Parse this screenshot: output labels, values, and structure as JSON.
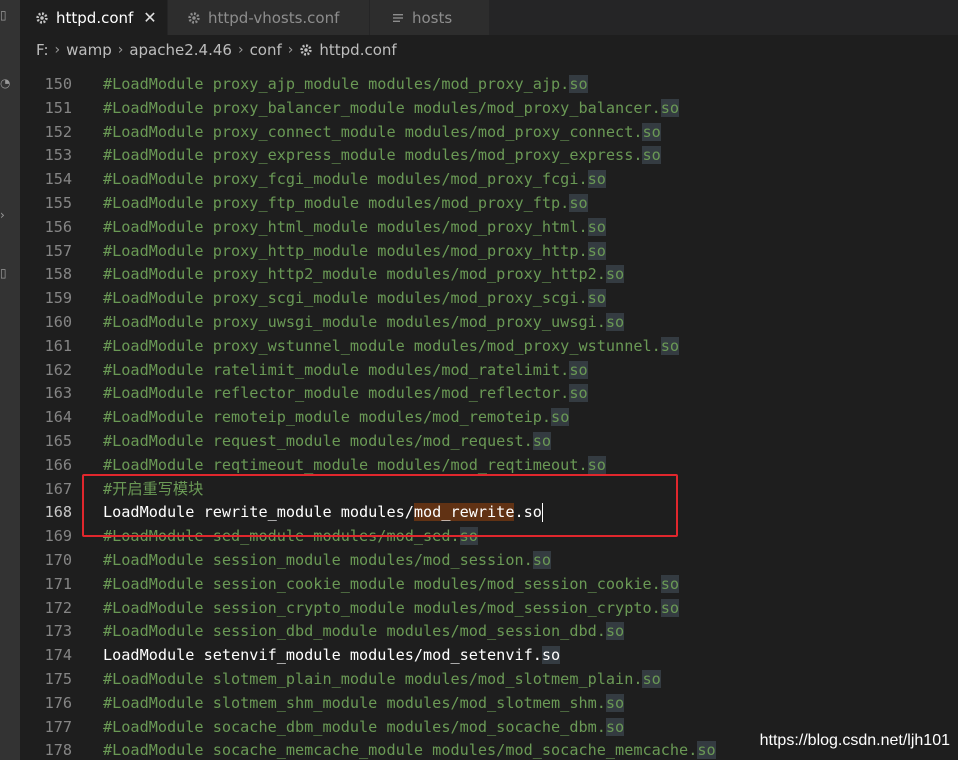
{
  "tabs": [
    {
      "label": "httpd.conf",
      "icon": "gear-icon",
      "active": true,
      "close": "✕"
    },
    {
      "label": "httpd-vhosts.conf",
      "icon": "gear-icon",
      "active": false
    },
    {
      "label": "hosts",
      "icon": "lines-icon",
      "active": false
    }
  ],
  "breadcrumb": [
    "F:",
    "wamp",
    "apache2.4.46",
    "conf",
    "httpd.conf"
  ],
  "editor": {
    "lines": [
      {
        "num": "150",
        "text": "#LoadModule proxy_ajp_module modules/mod_proxy_ajp.",
        "ext": "so",
        "comment": true
      },
      {
        "num": "151",
        "text": "#LoadModule proxy_balancer_module modules/mod_proxy_balancer.",
        "ext": "so",
        "comment": true
      },
      {
        "num": "152",
        "text": "#LoadModule proxy_connect_module modules/mod_proxy_connect.",
        "ext": "so",
        "comment": true
      },
      {
        "num": "153",
        "text": "#LoadModule proxy_express_module modules/mod_proxy_express.",
        "ext": "so",
        "comment": true
      },
      {
        "num": "154",
        "text": "#LoadModule proxy_fcgi_module modules/mod_proxy_fcgi.",
        "ext": "so",
        "comment": true
      },
      {
        "num": "155",
        "text": "#LoadModule proxy_ftp_module modules/mod_proxy_ftp.",
        "ext": "so",
        "comment": true
      },
      {
        "num": "156",
        "text": "#LoadModule proxy_html_module modules/mod_proxy_html.",
        "ext": "so",
        "comment": true
      },
      {
        "num": "157",
        "text": "#LoadModule proxy_http_module modules/mod_proxy_http.",
        "ext": "so",
        "comment": true
      },
      {
        "num": "158",
        "text": "#LoadModule proxy_http2_module modules/mod_proxy_http2.",
        "ext": "so",
        "comment": true
      },
      {
        "num": "159",
        "text": "#LoadModule proxy_scgi_module modules/mod_proxy_scgi.",
        "ext": "so",
        "comment": true
      },
      {
        "num": "160",
        "text": "#LoadModule proxy_uwsgi_module modules/mod_proxy_uwsgi.",
        "ext": "so",
        "comment": true
      },
      {
        "num": "161",
        "text": "#LoadModule proxy_wstunnel_module modules/mod_proxy_wstunnel.",
        "ext": "so",
        "comment": true
      },
      {
        "num": "162",
        "text": "#LoadModule ratelimit_module modules/mod_ratelimit.",
        "ext": "so",
        "comment": true
      },
      {
        "num": "163",
        "text": "#LoadModule reflector_module modules/mod_reflector.",
        "ext": "so",
        "comment": true
      },
      {
        "num": "164",
        "text": "#LoadModule remoteip_module modules/mod_remoteip.",
        "ext": "so",
        "comment": true
      },
      {
        "num": "165",
        "text": "#LoadModule request_module modules/mod_request.",
        "ext": "so",
        "comment": true
      },
      {
        "num": "166",
        "text": "#LoadModule reqtimeout_module modules/mod_reqtimeout.",
        "ext": "so",
        "comment": true
      },
      {
        "num": "167",
        "text": "#开启重写模块",
        "ext": "",
        "comment": true
      },
      {
        "num": "168",
        "text": "LoadModule rewrite_module modules/",
        "sel": "mod_rewrite",
        "after": ".so",
        "ext": "",
        "comment": false,
        "current": true
      },
      {
        "num": "169",
        "text": "#LoadModule sed_module modules/mod_sed.",
        "ext": "so",
        "comment": true
      },
      {
        "num": "170",
        "text": "#LoadModule session_module modules/mod_session.",
        "ext": "so",
        "comment": true
      },
      {
        "num": "171",
        "text": "#LoadModule session_cookie_module modules/mod_session_cookie.",
        "ext": "so",
        "comment": true
      },
      {
        "num": "172",
        "text": "#LoadModule session_crypto_module modules/mod_session_crypto.",
        "ext": "so",
        "comment": true
      },
      {
        "num": "173",
        "text": "#LoadModule session_dbd_module modules/mod_session_dbd.",
        "ext": "so",
        "comment": true
      },
      {
        "num": "174",
        "text": "LoadModule setenvif_module modules/mod_setenvif.",
        "ext": "so",
        "comment": false
      },
      {
        "num": "175",
        "text": "#LoadModule slotmem_plain_module modules/mod_slotmem_plain.",
        "ext": "so",
        "comment": true
      },
      {
        "num": "176",
        "text": "#LoadModule slotmem_shm_module modules/mod_slotmem_shm.",
        "ext": "so",
        "comment": true
      },
      {
        "num": "177",
        "text": "#LoadModule socache_dbm_module modules/mod_socache_dbm.",
        "ext": "so",
        "comment": true
      },
      {
        "num": "178",
        "text": "#LoadModule socache_memcache_module modules/mod_socache_memcache.",
        "ext": "so",
        "comment": true
      }
    ]
  },
  "watermark": "https://blog.csdn.net/ljh101",
  "colors": {
    "comment": "#6a9955",
    "plain": "#ffffff",
    "line_number": "#858585",
    "highlight_box": "#e0272d",
    "selection": "#613214"
  }
}
